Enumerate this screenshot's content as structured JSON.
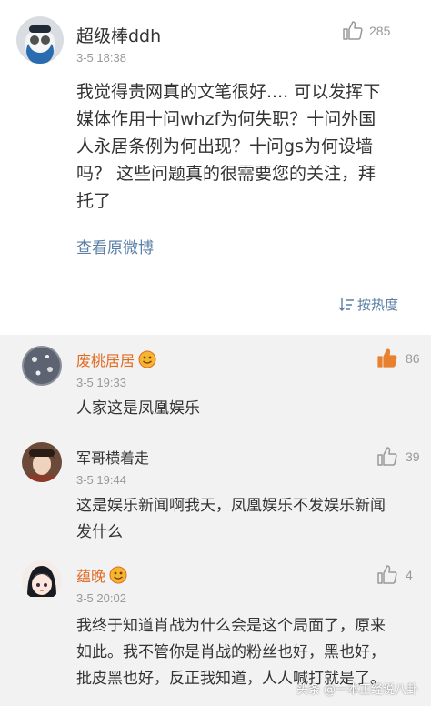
{
  "post": {
    "username": "超级棒ddh",
    "time": "3-5 18:38",
    "like_count": "285",
    "content_lines": [
      "我觉得贵网真的文笔很好.... 可以发挥下",
      "媒体作用十问whzf为何失职？十问外国",
      "人永居条例为何出现？十问gs为何设墙",
      "吗？ 这些问题真的很需要您的关注，拜",
      "托了"
    ],
    "view_original_link": "查看原微博",
    "sort_label": "按热度"
  },
  "comments": [
    {
      "username": "废桃居居",
      "username_color": "#e06c24",
      "time": "3-5 19:33",
      "like_count": "86",
      "liked": true,
      "has_badge": true,
      "content_lines": [
        "人家这是凤凰娱乐"
      ]
    },
    {
      "username": "军哥横着走",
      "username_color": "#333333",
      "time": "3-5 19:44",
      "like_count": "39",
      "liked": false,
      "has_badge": false,
      "content_lines": [
        "这是娱乐新闻啊我天，凤凰娱乐不发娱乐新闻",
        "发什么"
      ]
    },
    {
      "username": "蕴晚",
      "username_color": "#e06c24",
      "time": "3-5 20:02",
      "like_count": "4",
      "liked": false,
      "has_badge": true,
      "content_lines": [
        "我终于知道肖战为什么会是这个局面了，原来",
        "如此。我不管你是肖战的粉丝也好，黑也好，",
        "批皮黑也好，反正我知道，人人喊打就是了。"
      ]
    }
  ],
  "watermark": {
    "brand": "头条",
    "author": "@一本正经说八卦"
  },
  "colors": {
    "link": "#5b7fa6",
    "liked": "#e8812f",
    "muted": "#999999",
    "comments_bg": "#f2f2f2"
  }
}
